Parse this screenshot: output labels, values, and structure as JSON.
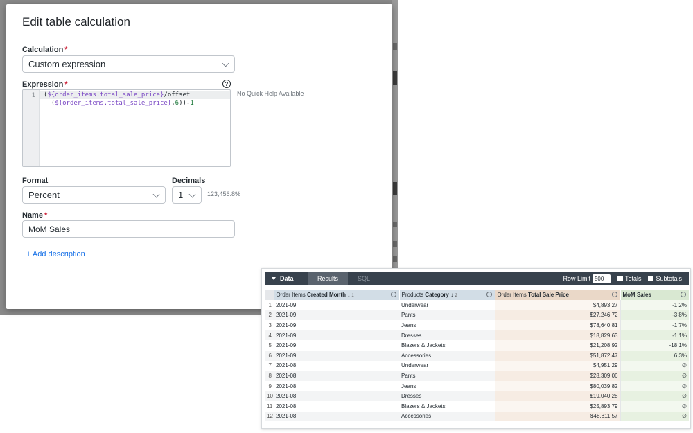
{
  "modal": {
    "title": "Edit table calculation",
    "calculation": {
      "label": "Calculation",
      "required_mark": "*",
      "value": "Custom expression"
    },
    "expression": {
      "label": "Expression",
      "required_mark": "*",
      "line_number": "1",
      "quick_help": "No Quick Help Available",
      "help_icon": "help-circle-icon"
    },
    "format": {
      "label": "Format",
      "value": "Percent"
    },
    "decimals": {
      "label": "Decimals",
      "value": "1",
      "preview": "123,456.8%"
    },
    "name": {
      "label": "Name",
      "required_mark": "*",
      "value": "MoM Sales"
    },
    "add_description": "+ Add description"
  },
  "data_panel": {
    "toolbar": {
      "data_label": "Data",
      "tabs": [
        "Results",
        "SQL"
      ],
      "row_limit_label": "Row Limit",
      "row_limit_value": "500",
      "totals_label": "Totals",
      "subtotals_label": "Subtotals"
    },
    "columns": [
      {
        "prefix": "Order Items ",
        "name": "Created Month",
        "sort": "↓",
        "sort_index": "1"
      },
      {
        "prefix": "Products ",
        "name": "Category",
        "sort": "↓",
        "sort_index": "2"
      },
      {
        "prefix": "Order Items ",
        "name": "Total Sale Price",
        "sort": "",
        "sort_index": ""
      },
      {
        "prefix": "",
        "name": "MoM Sales",
        "sort": "",
        "sort_index": ""
      }
    ],
    "rows": [
      {
        "n": "1",
        "month": "2021-09",
        "category": "Underwear",
        "price": "$4,893.27",
        "mom": "-1.2%"
      },
      {
        "n": "2",
        "month": "2021-09",
        "category": "Pants",
        "price": "$27,246.72",
        "mom": "-3.8%"
      },
      {
        "n": "3",
        "month": "2021-09",
        "category": "Jeans",
        "price": "$78,640.81",
        "mom": "-1.7%"
      },
      {
        "n": "4",
        "month": "2021-09",
        "category": "Dresses",
        "price": "$18,829.63",
        "mom": "-1.1%"
      },
      {
        "n": "5",
        "month": "2021-09",
        "category": "Blazers & Jackets",
        "price": "$21,208.92",
        "mom": "-18.1%"
      },
      {
        "n": "6",
        "month": "2021-09",
        "category": "Accessories",
        "price": "$51,872.47",
        "mom": "6.3%"
      },
      {
        "n": "7",
        "month": "2021-08",
        "category": "Underwear",
        "price": "$4,951.29",
        "mom": "∅"
      },
      {
        "n": "8",
        "month": "2021-08",
        "category": "Pants",
        "price": "$28,309.06",
        "mom": "∅"
      },
      {
        "n": "9",
        "month": "2021-08",
        "category": "Jeans",
        "price": "$80,039.82",
        "mom": "∅"
      },
      {
        "n": "10",
        "month": "2021-08",
        "category": "Dresses",
        "price": "$19,040.28",
        "mom": "∅"
      },
      {
        "n": "11",
        "month": "2021-08",
        "category": "Blazers & Jackets",
        "price": "$25,893.79",
        "mom": "∅"
      },
      {
        "n": "12",
        "month": "2021-08",
        "category": "Accessories",
        "price": "$48,811.57",
        "mom": "∅"
      }
    ]
  },
  "colors": {
    "dimension_header": "#d2dde6",
    "measure_header": "#ead8c8",
    "calculation_header": "#d9e8d2",
    "toolbar": "#38424d",
    "link": "#1a73e8",
    "required": "#cc1f36"
  }
}
